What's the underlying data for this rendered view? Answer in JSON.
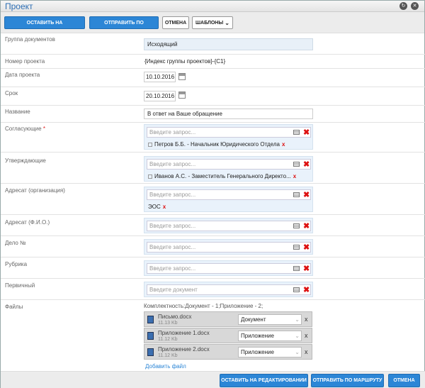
{
  "window": {
    "title": "Проект"
  },
  "toolbar": {
    "keep_editing": "ОСТАВИТЬ НА РЕДАКТИРОВАНИИ",
    "send_route": "ОТПРАВИТЬ ПО МАРШРУТУ",
    "cancel": "ОТМЕНА",
    "templates": "ШАБЛОНЫ"
  },
  "form": {
    "doc_group": {
      "label": "Группа документов",
      "value": "Исходящий"
    },
    "project_number": {
      "label": "Номер проекта",
      "value": "{Индекс группы проектов}-{С1}"
    },
    "project_date": {
      "label": "Дата проекта",
      "value": "10.10.2016"
    },
    "due_date": {
      "label": "Срок",
      "value": "20.10.2016"
    },
    "name": {
      "label": "Название",
      "value": "В ответ на Ваше обращение"
    },
    "approvers": {
      "label": "Согласующие",
      "required_mark": "*",
      "placeholder": "Введите запрос...",
      "chip": "Петров Б.Б. - Начальник Юридического Отдела"
    },
    "confirmers": {
      "label": "Утверждающие",
      "placeholder": "Введите запрос...",
      "chip": "Иванов А.С. - Заместитель Генерального Директо..."
    },
    "addressee_org": {
      "label": "Адресат (организация)",
      "placeholder": "Введите запрос...",
      "chip": "ЭОС"
    },
    "addressee_person": {
      "label": "Адресат (Ф.И.О.)",
      "placeholder": "Введите запрос..."
    },
    "case": {
      "label": "Дело №",
      "placeholder": "Введите запрос..."
    },
    "rubric": {
      "label": "Рубрика",
      "placeholder": "Введите запрос..."
    },
    "primary": {
      "label": "Первичный",
      "placeholder": "Введите документ"
    },
    "files": {
      "label": "Файлы",
      "summary": "Комплектность:Документ - 1;Приложение - 2;",
      "items": [
        {
          "name": "Письмо.docx",
          "size": "11.13 Kb",
          "type": "Документ"
        },
        {
          "name": "Приложение 1.docx",
          "size": "11.12 Kb",
          "type": "Приложение"
        },
        {
          "name": "Приложение 2.docx",
          "size": "11.12 Kb",
          "type": "Приложение"
        }
      ],
      "add_link": "Добавить файл"
    }
  },
  "footer": {
    "keep_editing": "ОСТАВИТЬ НА РЕДАКТИРОВАНИИ",
    "send_route": "ОТПРАВИТЬ ПО МАРШРУТУ",
    "cancel": "ОТМЕНА"
  }
}
